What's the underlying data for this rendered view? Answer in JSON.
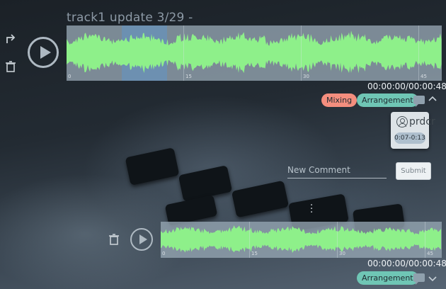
{
  "track1": {
    "title": "track1 update 3/29 -",
    "ticks": [
      "0",
      "15",
      "30",
      "45"
    ],
    "time": "00:00:00/00:00:48",
    "tags": [
      "Mixing",
      "Arrangement"
    ],
    "waveform_color": "#8ef08a"
  },
  "comment": {
    "username": "prdcr",
    "range": "0:07-0:13"
  },
  "new_comment": {
    "placeholder": "New Comment",
    "submit_label": "Submit"
  },
  "track2": {
    "ticks": [
      "0",
      "15",
      "30",
      "45"
    ],
    "time": "00:00:00/00:00:48",
    "tags": [
      "Arrangement"
    ]
  },
  "icons": {
    "share": "share-arrow-icon",
    "delete": "trash-icon",
    "play": "play-circle-icon",
    "comments": "comment-icon",
    "collapse": "chevron-up-icon",
    "expand": "chevron-down-icon",
    "more": "kebab-menu-icon",
    "user": "user-circle-icon"
  }
}
